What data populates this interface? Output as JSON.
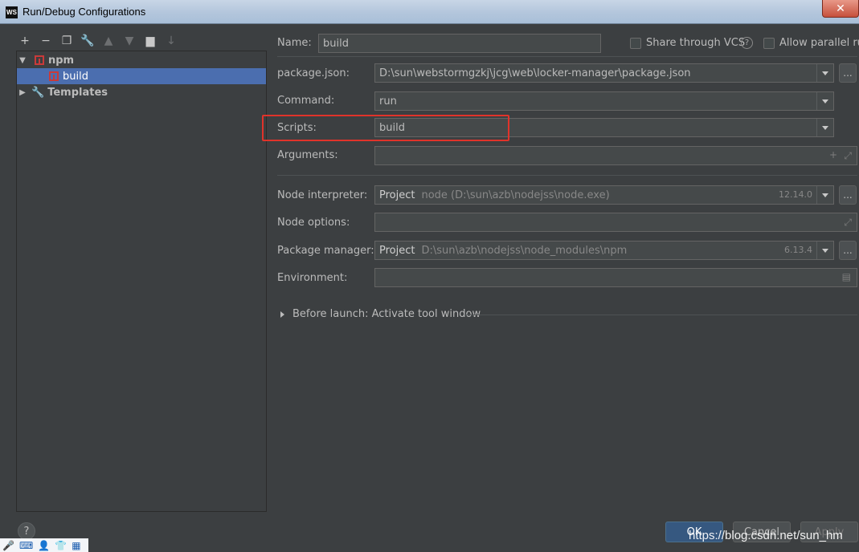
{
  "window": {
    "title": "Run/Debug Configurations",
    "logo": "WS"
  },
  "toolbar": {
    "icons": [
      "plus-icon",
      "minus-icon",
      "copy-icon",
      "wrench-icon",
      "arrow-up-icon",
      "arrow-down-icon",
      "folder-icon",
      "sort-icon"
    ]
  },
  "tree": {
    "npm_label": "npm",
    "build_label": "build",
    "templates_label": "Templates"
  },
  "form": {
    "name_label": "Name:",
    "name_value": "build",
    "share_vcs_label": "Share through VCS",
    "allow_parallel_label": "Allow parallel ru",
    "package_json_label": "package.json:",
    "package_json_value": "D:\\sun\\webstormgzkj\\jcg\\web\\locker-manager\\package.json",
    "command_label": "Command:",
    "command_value": "run",
    "scripts_label": "Scripts:",
    "scripts_value": "build",
    "arguments_label": "Arguments:",
    "node_interpreter_label": "Node interpreter:",
    "node_interpreter_project": "Project",
    "node_interpreter_path": "node (D:\\sun\\azb\\nodejss\\node.exe)",
    "node_interpreter_version": "12.14.0",
    "node_options_label": "Node options:",
    "package_manager_label": "Package manager:",
    "package_manager_project": "Project",
    "package_manager_path": "D:\\sun\\azb\\nodejss\\node_modules\\npm",
    "package_manager_version": "6.13.4",
    "environment_label": "Environment:",
    "before_launch_label": "Before launch: Activate tool window"
  },
  "buttons": {
    "ok": "OK",
    "cancel": "Cancel",
    "apply": "Apply",
    "browse": "..."
  },
  "watermark": "https://blog.csdn.net/sun_hm",
  "colors": {
    "highlight": "#e0332a",
    "selection": "#4b6eaf",
    "ok_button": "#365880"
  }
}
